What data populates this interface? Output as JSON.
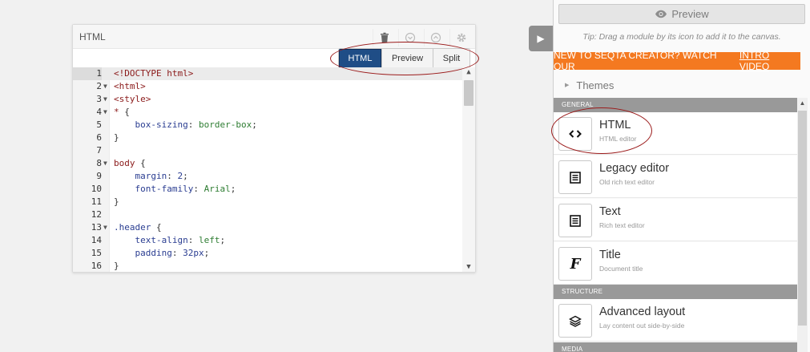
{
  "editor_card": {
    "title": "HTML",
    "header_icons": [
      "trash-icon",
      "move-down-icon",
      "move-up-icon",
      "gear-icon"
    ],
    "modes": [
      "HTML",
      "Preview",
      "Split"
    ],
    "active_mode": "HTML",
    "lines": [
      {
        "n": "1",
        "fold": false,
        "current": true
      },
      {
        "n": "2",
        "fold": true
      },
      {
        "n": "3",
        "fold": true
      },
      {
        "n": "4",
        "fold": true
      },
      {
        "n": "5",
        "fold": false
      },
      {
        "n": "6",
        "fold": false
      },
      {
        "n": "7",
        "fold": false
      },
      {
        "n": "8",
        "fold": true
      },
      {
        "n": "9",
        "fold": false
      },
      {
        "n": "10",
        "fold": false
      },
      {
        "n": "11",
        "fold": false
      },
      {
        "n": "12",
        "fold": false
      },
      {
        "n": "13",
        "fold": true
      },
      {
        "n": "14",
        "fold": false
      },
      {
        "n": "15",
        "fold": false
      },
      {
        "n": "16",
        "fold": false
      }
    ],
    "code": [
      "<!DOCTYPE html>",
      "<html>",
      "<style>",
      "* {",
      "    box-sizing: border-box;",
      "}",
      "",
      "body {",
      "    margin: 2;",
      "    font-family: Arial;",
      "}",
      "",
      ".header {",
      "    text-align: left;",
      "    padding: 32px;",
      "}"
    ]
  },
  "sidebar": {
    "preview_label": "Preview",
    "tip": "Tip: Drag a module by its icon to add it to the canvas.",
    "promo_text": "NEW TO SEQTA CREATOR? WATCH OUR",
    "promo_link": "INTRO VIDEO",
    "promo_color": "#f47920",
    "themes_label": "Themes",
    "sections": [
      {
        "title": "GENERAL",
        "modules": [
          {
            "name": "HTML",
            "desc": "HTML editor",
            "icon": "code-icon"
          },
          {
            "name": "Legacy editor",
            "desc": "Old rich text editor",
            "icon": "document-icon"
          },
          {
            "name": "Text",
            "desc": "Rich text editor",
            "icon": "document-icon"
          },
          {
            "name": "Title",
            "desc": "Document title",
            "icon": "title-font-icon"
          }
        ]
      },
      {
        "title": "STRUCTURE",
        "modules": [
          {
            "name": "Advanced layout",
            "desc": "Lay content out side-by-side",
            "icon": "layers-icon"
          }
        ]
      },
      {
        "title": "MEDIA",
        "modules": []
      }
    ]
  },
  "colors": {
    "active_mode": "#1f4d86",
    "highlight_oval": "#9b1b1b",
    "section_header": "#999999"
  }
}
